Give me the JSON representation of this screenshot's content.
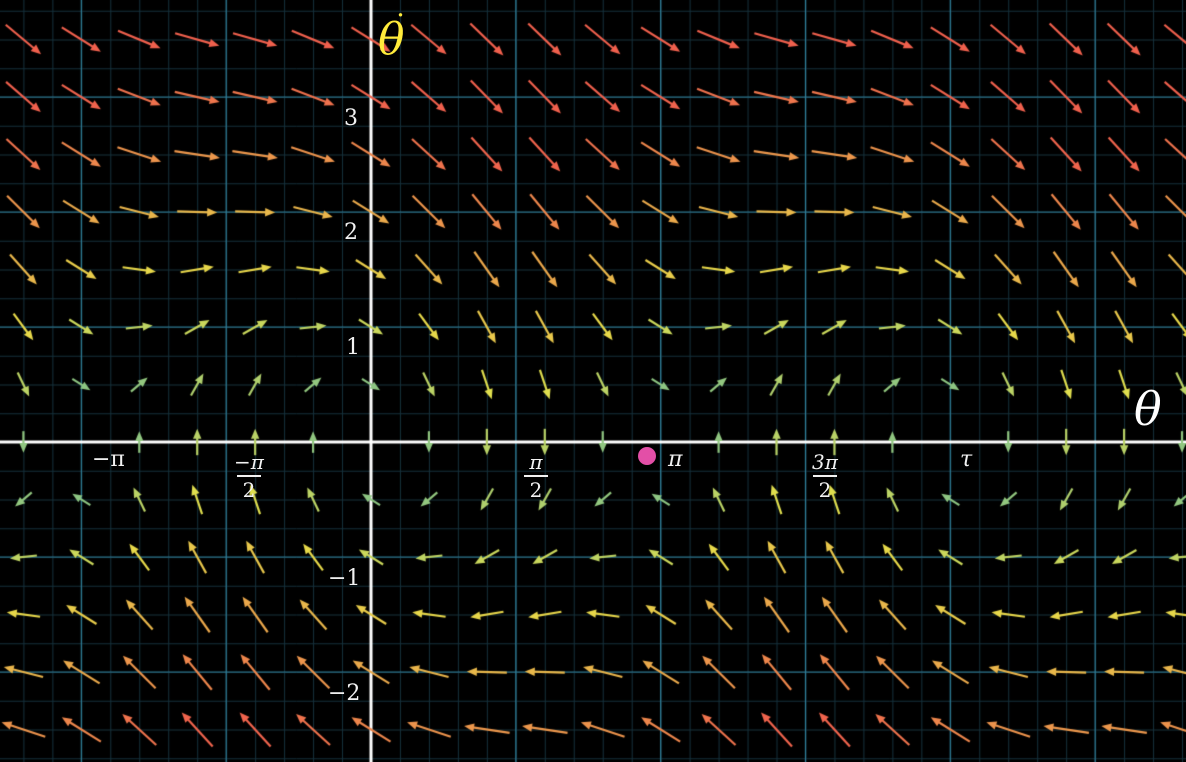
{
  "phase_plot": {
    "y_axis_label": "θ",
    "y_axis_dot": "˙",
    "x_axis_label": "θ",
    "y_ticks": [
      "3",
      "2",
      "1",
      "−1",
      "−2"
    ],
    "x_ticks": {
      "neg_pi": "−π",
      "neg_pi_half_num": "−π",
      "neg_pi_half_den": "2",
      "pi_half_num": "π",
      "pi_half_den": "2",
      "pi": "π",
      "three_pi_half_num": "3π",
      "three_pi_half_den": "2",
      "tau": "τ"
    },
    "vector_field": "θ' = θ̇, θ̇' = −μ·θ̇ − sin(θ)",
    "colors": {
      "background": "#000000",
      "axes": "#ffffff",
      "grid_major": "#2f7f9a",
      "grid_minor": "#16323d",
      "state_point": "#e34fa7",
      "slow": "#4fb3a9",
      "medium": "#e6e04a",
      "fast": "#f0604d"
    }
  },
  "chart_data": {
    "type": "vector_field",
    "x_domain": [
      -4.3,
      9.1
    ],
    "y_domain": [
      -2.75,
      3.85
    ],
    "damping_mu": 0.5,
    "state_point": {
      "theta": 3.06,
      "theta_dot": -0.1
    }
  }
}
